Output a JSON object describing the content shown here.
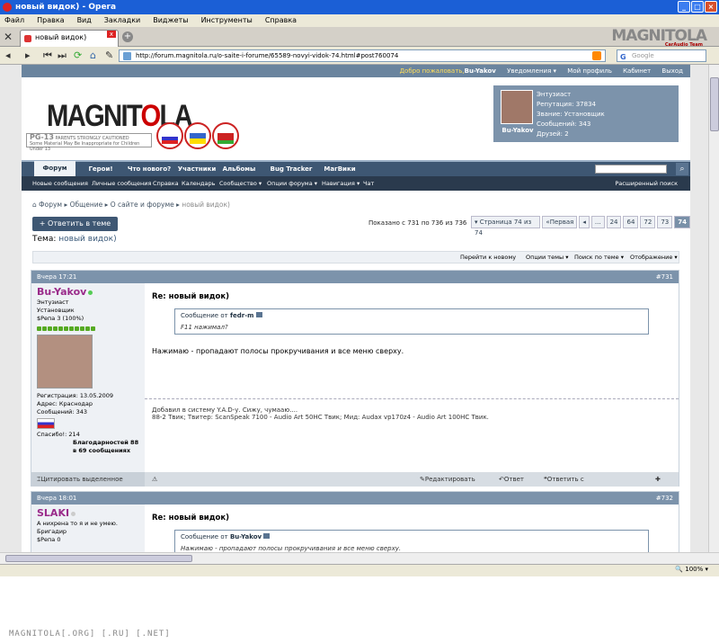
{
  "window": {
    "title": "новый видок) - Opera",
    "buttons": [
      "_",
      "□",
      "×"
    ]
  },
  "menu": [
    "Файл",
    "Правка",
    "Вид",
    "Закладки",
    "Виджеты",
    "Инструменты",
    "Справка"
  ],
  "tab": {
    "label": "новый видок)"
  },
  "brand": {
    "logo": "MAGNITOLA",
    "sub": "CarAudio Team"
  },
  "url": "http://forum.magnitola.ru/o-saite-i-forume/65589-novyi-vidok-74.html#post760074",
  "search_placeholder": "Google",
  "site": {
    "topbar": {
      "welcome": "Добро пожаловать,",
      "user": "Bu-Yakov",
      "links": [
        "Уведомления ▾",
        "Мой профиль",
        "Кабинет",
        "Выход"
      ]
    },
    "logo_text": "MAGNIT",
    "logo_o": "O",
    "logo_rest": "LA",
    "logo_team": "TEAM",
    "pg13_title": "PG-13",
    "pg13_line1": "PARENTS STRONGLY CAUTIONED",
    "pg13_line2": "Some Material May Be Inappropriate for Children Under 13",
    "userbox": {
      "name": "Bu-Yakov",
      "rank": "Энтузиаст",
      "rep": "Репутация: 37834",
      "title": "Звание: Установщик",
      "posts": "Сообщений: 343",
      "friends": "Друзей: 2"
    },
    "nav": [
      "Форум",
      "Герои!",
      "Что нового?",
      "Участники",
      "Альбомы",
      "Bug Tracker",
      "МагВики"
    ],
    "subnav": [
      "Новые сообщения",
      "Личные сообщения",
      "Справка",
      "Календарь",
      "Сообщество ▾",
      "Опции форума ▾",
      "Навигация ▾",
      "Чат"
    ],
    "advanced_search": "Расширенный поиск",
    "breadcrumb": [
      "Форум",
      "Общение",
      "О сайте и форуме",
      "новый видок)"
    ],
    "reply_button": "+ Ответить в теме",
    "topic_label": "Тема:",
    "topic_name": "новый видок)",
    "shown": "Показано с 731 по 736 из 736",
    "pager": [
      "▾ Страница 74 из 74",
      "«Первая",
      "◂",
      "...",
      "24",
      "64",
      "72",
      "73",
      "74"
    ],
    "tools": [
      "Перейти к новому",
      "Опции темы ▾",
      "Поиск по теме ▾",
      "Отображение ▾"
    ]
  },
  "posts": [
    {
      "date": "Вчера 17:21",
      "num": "#731",
      "user": "Bu-Yakov",
      "rank": "Энтузиаст",
      "title": "Установщик",
      "rep": "$Репа 3 (100%)",
      "reg": "Регистрация:   13.05.2009",
      "addr": "Адрес:          Краснодар",
      "count": "Сообщений:     343",
      "thanks": "Спасибо!:       214",
      "thanks2": "Благодарностей 88 в 69 сообщениях",
      "post_title": "Re: новый видок)",
      "quote_head": "Сообщение от",
      "quote_user": "fedr-m",
      "quote_body": "F11 нажимал?",
      "body": "Нажимаю - пропадают полосы прокручивания и все меню сверху.",
      "sig1": "Добавил в систему Y.A.D-у. Сижу, чумаaю....",
      "sig2": "88-2 Твик; Твитер: ScanSpeak 7100 - Audio Art 50HC Твик; Мид: Audax vp170z4 - Audio Art 100HC Твик.",
      "foot": [
        "Цитировать выделенное",
        "Редактировать",
        "Ответ",
        "Ответить с цитированием"
      ]
    },
    {
      "date": "Вчера 18:01",
      "num": "#732",
      "user": "SLAKI",
      "rank": "А нихрена то я и не умею.",
      "title": "Бригадир",
      "rep": "$Репа 0",
      "post_title": "Re: новый видок)",
      "quote_head": "Сообщение от",
      "quote_user": "Bu-Yakov",
      "quote_body": "Нажимаю - пропадают полосы прокручивания и все меню сверху."
    }
  ],
  "status": {
    "zoom": "100%"
  },
  "footer": "MAGNITOLA[.ORG] [.RU] [.NET]"
}
